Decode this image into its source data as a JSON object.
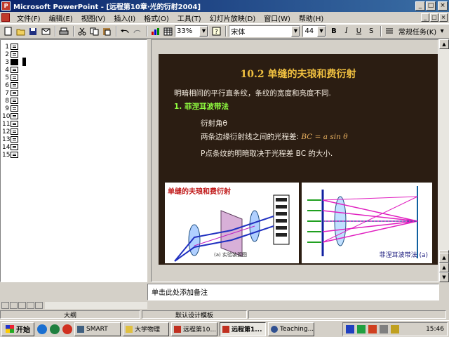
{
  "window": {
    "title": "Microsoft PowerPoint - [远程第10章·光的衍射2004]",
    "controls": [
      "_",
      "□",
      "×"
    ]
  },
  "menubar": {
    "items": [
      "文件(F)",
      "编辑(E)",
      "视图(V)",
      "插入(I)",
      "格式(O)",
      "工具(T)",
      "幻灯片放映(D)",
      "窗口(W)",
      "帮助(H)"
    ],
    "doc_controls": [
      "_",
      "□",
      "×"
    ]
  },
  "toolbar": {
    "zoom": "33%",
    "font_name": "宋体",
    "font_size": "44",
    "bold_label": "B",
    "italic_label": "I",
    "underline_label": "U",
    "shadow_label": "S",
    "tasks_label": "常规任务(K)"
  },
  "outline": {
    "slides": [
      "1",
      "2",
      "3",
      "4",
      "5",
      "6",
      "7",
      "8",
      "9",
      "10",
      "11",
      "12",
      "13",
      "14",
      "15"
    ],
    "active_index": 2
  },
  "slide": {
    "heading": "10.2  单缝的夫琅和费衍射",
    "line1": "明暗相间的平行直条纹，条纹的宽度和亮度不同.",
    "line2": "1. 菲涅耳波带法",
    "line3": "衍射角θ",
    "line4_prefix": "两条边缘衍射线之间的光程差:",
    "line4_formula": "BC = a sin θ",
    "line5": "P点条纹的明暗取决于光程差 BC 的大小.",
    "fig_left_caption": "单缝的夫琅和费衍射",
    "fig_left_sub": "(a) 实验装置图",
    "fig_right_caption": "菲涅耳波带法 (a)"
  },
  "notes": {
    "placeholder": "单击此处添加备注"
  },
  "statusbar": {
    "outline_label": "大纲",
    "design_label": "默认设计模板"
  },
  "taskbar": {
    "start_label": "开始",
    "tasks": [
      "SMART",
      "大学物理",
      "远程第10...",
      "远程第1...",
      "Teaching..."
    ],
    "active_task": 3,
    "clock": "15:46"
  },
  "colors": {
    "slide_bg": "#2b1d12",
    "heading": "#f0c040",
    "subheading": "#90ff40",
    "body_text": "#f4ece0",
    "title_gradient_start": "#0a246a"
  }
}
